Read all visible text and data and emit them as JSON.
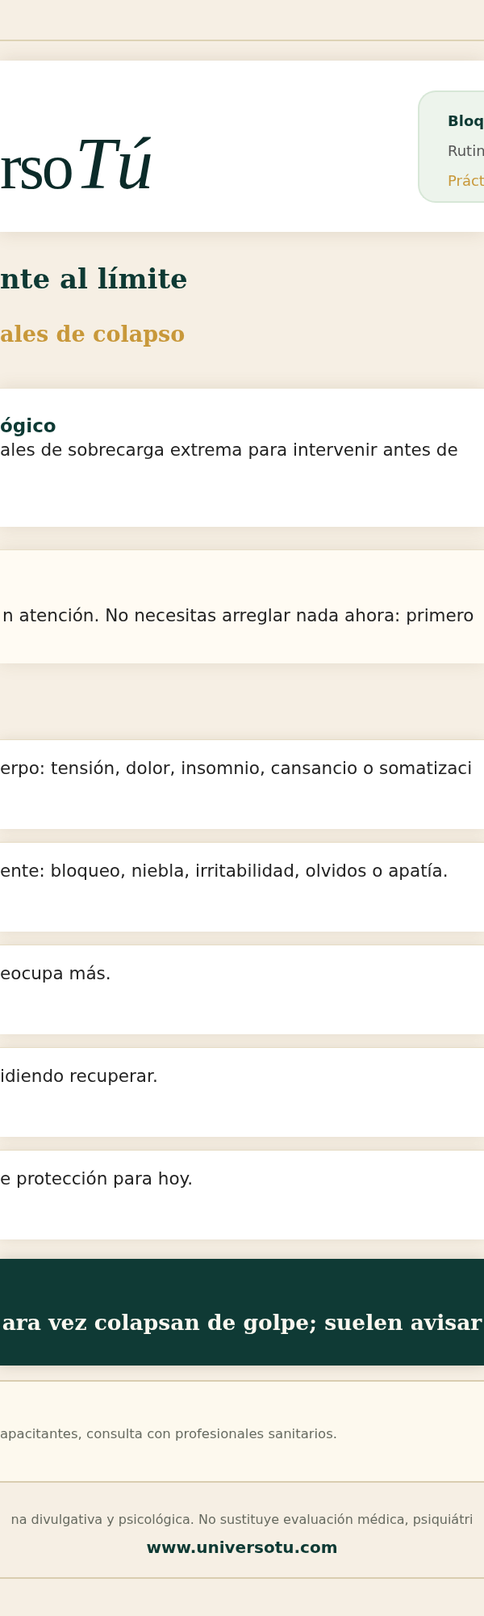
{
  "header": {
    "logo": {
      "wordmark": "rso",
      "script": "Tú"
    },
    "badge": {
      "title": "Bloq",
      "subtitle": "Rutin",
      "tag": "Práct"
    }
  },
  "hero": {
    "title": "nte al límite",
    "subtitle": "ales de colapso"
  },
  "intro_card": {
    "title": "ógico",
    "text": "ales de sobrecarga extrema para intervenir antes de"
  },
  "note": {
    "text": "n atención. No necesitas arreglar nada ahora: primero"
  },
  "signals": [
    {
      "text": "erpo: tensión, dolor, insomnio, cansancio o somatizaci"
    },
    {
      "text": "ente: bloqueo, niebla, irritabilidad, olvidos o apatía."
    },
    {
      "text": "eocupa más."
    },
    {
      "text": "idiendo recuperar."
    },
    {
      "text": "e protección para hoy."
    }
  ],
  "banner": {
    "text": "ara vez colapsan de golpe; suelen avisar"
  },
  "disclaimer": {
    "text": "apacitantes, consulta con profesionales sanitarios."
  },
  "footer": {
    "text": "na divulgativa y psicológica. No sustituye evaluación médica, psiquiátri",
    "link": "www.universotu.com"
  }
}
